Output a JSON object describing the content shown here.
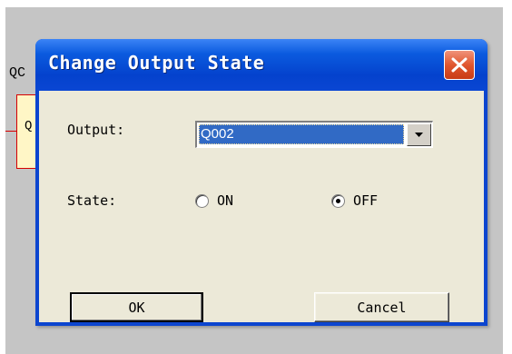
{
  "background": {
    "label": "QC",
    "box_text": "Q"
  },
  "dialog": {
    "title": "Change Output State",
    "close_icon": "close-x-icon",
    "output_label": "Output:",
    "output_value": "Q002",
    "dropdown_icon": "chevron-down-icon",
    "state_label": "State:",
    "state_options": [
      {
        "label": "ON",
        "selected": false
      },
      {
        "label": "OFF",
        "selected": true
      }
    ],
    "ok_label": "OK",
    "cancel_label": "Cancel"
  },
  "colors": {
    "titlebar": "#0b5bdf",
    "client": "#ece9d8",
    "selection": "#316ac5",
    "close": "#e0562e"
  }
}
